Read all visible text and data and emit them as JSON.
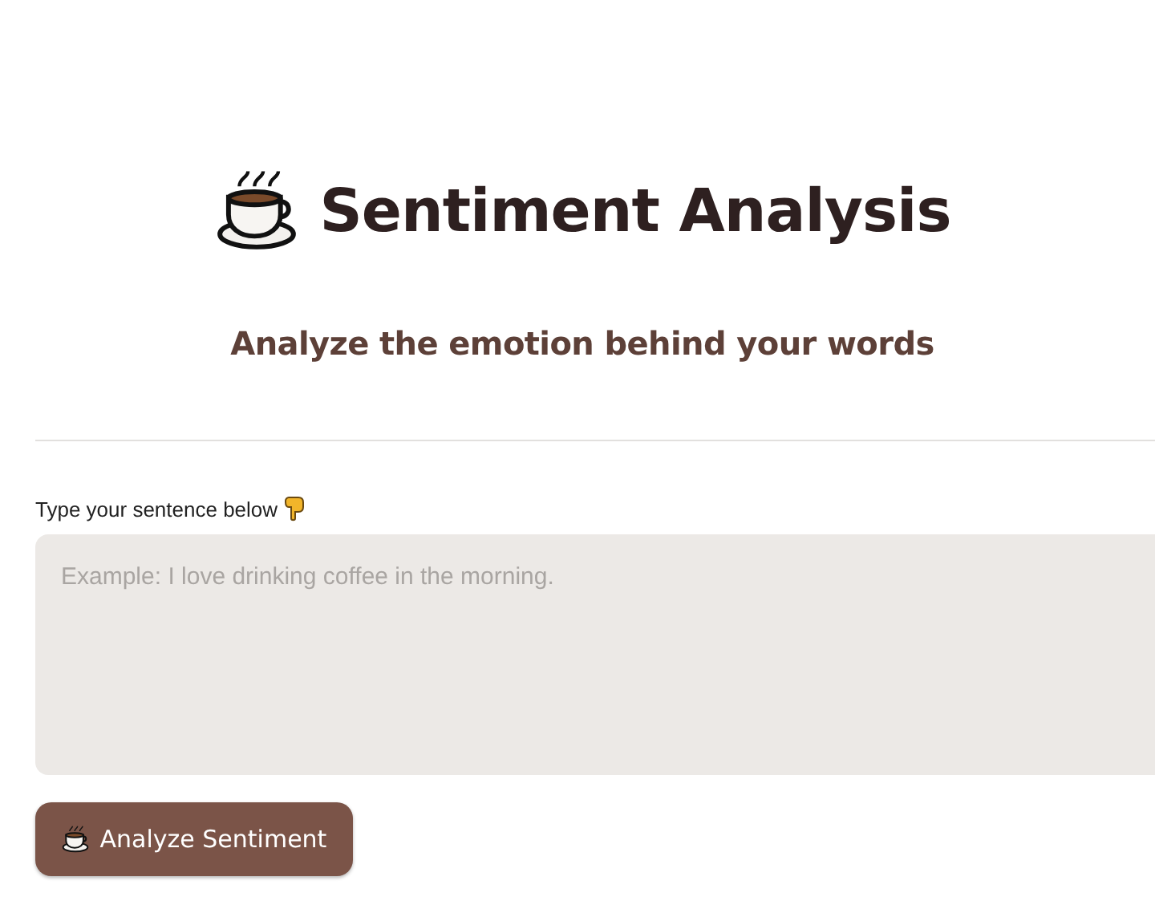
{
  "header": {
    "title": "Sentiment Analysis",
    "subtitle": "Analyze the emotion behind your words"
  },
  "input": {
    "label": "Type your sentence below",
    "placeholder": "Example: I love drinking coffee in the morning."
  },
  "button": {
    "label": "Analyze Sentiment"
  }
}
